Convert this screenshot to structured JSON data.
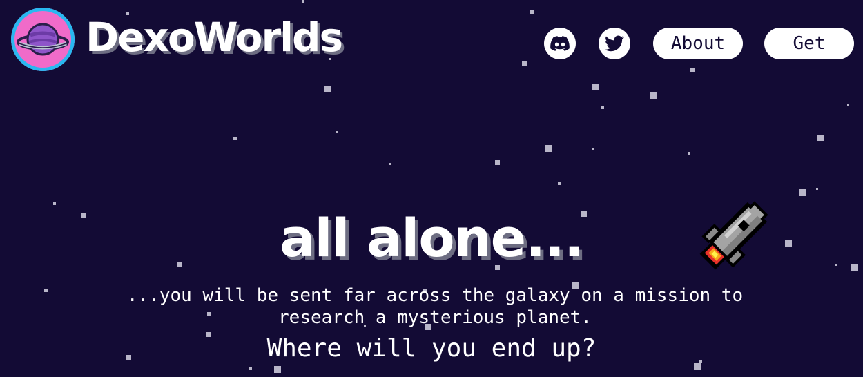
{
  "header": {
    "brand": "DexoWorlds",
    "logo_icon": "planet-logo-icon",
    "nav": {
      "discord_icon": "discord-icon",
      "twitter_icon": "twitter-icon",
      "about_label": "About",
      "get_label": "Get"
    }
  },
  "hero": {
    "title": "all alone...",
    "subtitle_line1": "...you will be sent far across the galaxy on a mission to",
    "subtitle_line2": "research a mysterious planet.",
    "question": "Where will you end up?",
    "illustration_icon": "pixel-rocket-icon"
  },
  "colors": {
    "background": "#130b35",
    "logo_pink": "#f06bc9",
    "logo_ring": "#29b8f0",
    "button_bg": "#ffffff",
    "button_text": "#130b35"
  }
}
